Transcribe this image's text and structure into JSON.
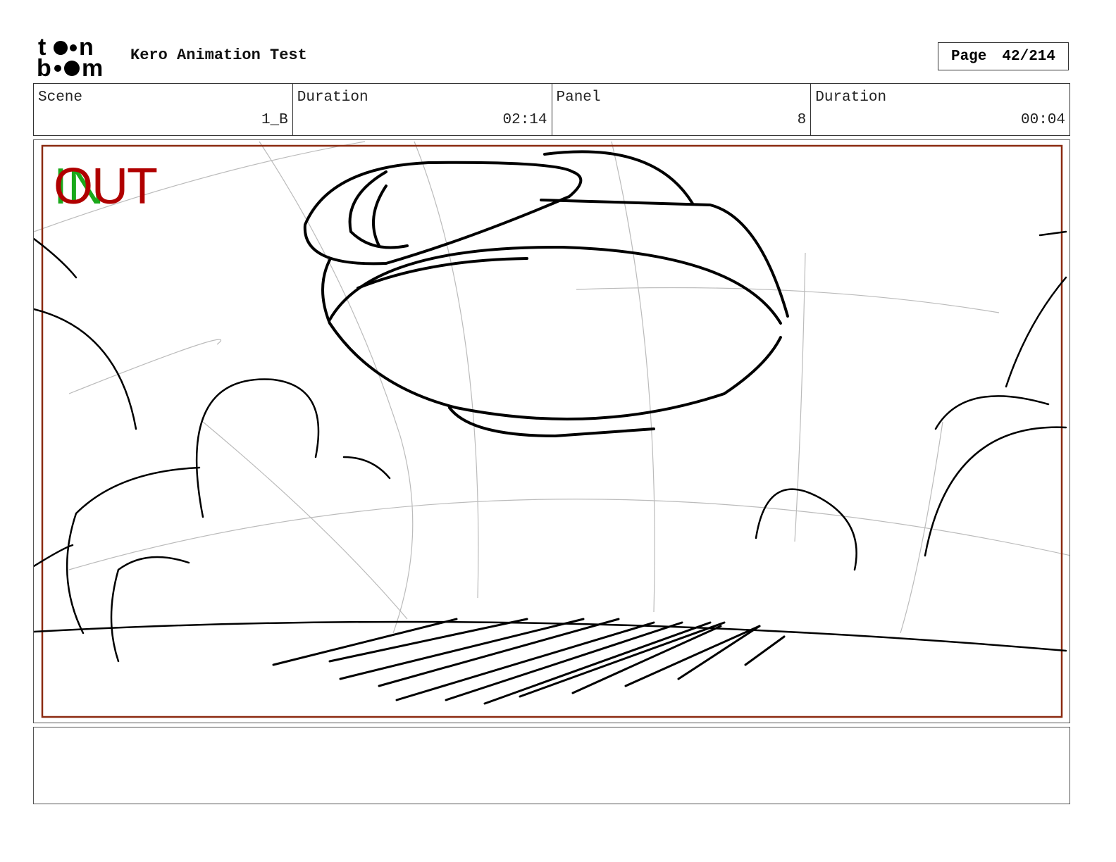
{
  "header": {
    "logo_text": "toon boom",
    "project_title": "Kero Animation Test",
    "page_label": "Page",
    "page_value": "42/214"
  },
  "info": [
    {
      "label": "Scene",
      "value": "1_B"
    },
    {
      "label": "Duration",
      "value": "02:14"
    },
    {
      "label": "Panel",
      "value": "8"
    },
    {
      "label": "Duration",
      "value": "00:04"
    }
  ],
  "panel": {
    "in_marker": "IN",
    "out_marker": "OUT",
    "frame_color": "#8b2a10"
  },
  "notes": {
    "text": ""
  }
}
